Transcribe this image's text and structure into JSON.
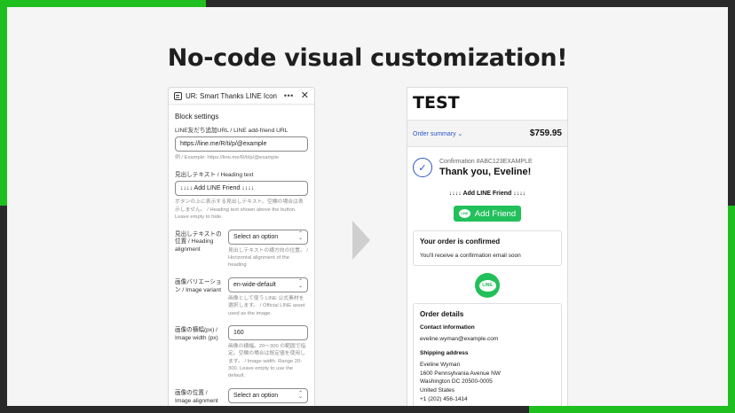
{
  "headline": "No-code visual customization!",
  "editor": {
    "title": "UR: Smart Thanks LINE Icon",
    "more_glyph": "•••",
    "close_glyph": "✕",
    "section_title": "Block settings",
    "url_label": "LINE友だち追加URL / LINE add-friend URL",
    "url_value": "https://line.me/R/ti/p/@example",
    "url_help": "例 / Example: https://line.me/R/ti/p/@example",
    "heading_label": "見出しテキスト / Heading text",
    "heading_value": "↓↓↓↓ Add LINE Friend ↓↓↓↓",
    "heading_help": "ボタンの上に表示する見出しテキスト。空欄の場合は表示しません。 / Heading text shown above the button. Leave empty to hide.",
    "align_label": "見出しテキストの位置 / Heading alignment",
    "align_value": "Select an option",
    "align_help": "見出しテキストの横方向の位置。 / Horizontal alignment of the heading",
    "variant_label": "画像バリエーション / Image variant",
    "variant_value": "en-wide-default",
    "variant_help": "画像として使う LINE 公式素材を選択します。 / Official LINE asset used as the image.",
    "width_label": "画像の横幅(px) / Image width (px)",
    "width_value": "160",
    "width_help": "画像の横幅。20～300 の範囲で指定。空欄の場合は既定値を使用します。 / Image width. Range 20-300. Leave empty to use the default.",
    "position_label": "画像の位置 / Image alignment",
    "position_value": "Select an option"
  },
  "preview": {
    "store_name": "TEST",
    "order_summary": "Order summary ⌄",
    "total": "$759.95",
    "confirmation": "Confirmation #ABC123EXAMPLE",
    "thank_you": "Thank you, Eveline!",
    "heading_text": "↓↓↓↓ Add LINE Friend ↓↓↓↓",
    "add_friend": "Add Friend",
    "line_logo_text": "LINE",
    "confirmed_title": "Your order is confirmed",
    "confirmed_text": "You'll receive a confirmation email soon",
    "details_title": "Order details",
    "contact_title": "Contact information",
    "contact_email": "eveline.wyman@example.com",
    "shipping_title": "Shipping address",
    "shipping_name": "Eveline Wyman",
    "shipping_line1": "1600 Pennsylvania Avenue NW",
    "shipping_line2": "Washington DC 20500-0005",
    "shipping_country": "United States",
    "shipping_phone": "+1 (202) 456-1414"
  },
  "icons": {
    "check": "✓",
    "chevron_up": "⌃",
    "chevron_down": "⌄"
  },
  "colors": {
    "brand_green": "#22c05a",
    "frame_green": "#1fbf1f",
    "link_blue": "#2a55c4"
  }
}
